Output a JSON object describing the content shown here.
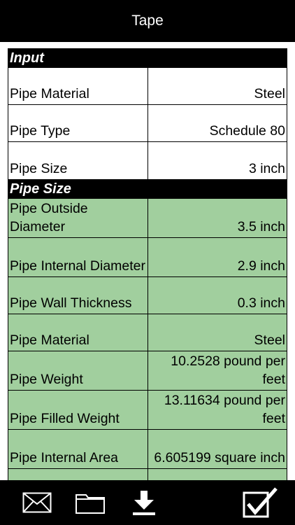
{
  "title": "Tape",
  "colors": {
    "bar": "#000000",
    "result_bg": "#a1cf9e"
  },
  "sections": {
    "input": {
      "header": "Input",
      "rows": [
        {
          "label": "Pipe Material",
          "value": "Steel"
        },
        {
          "label": "Pipe Type",
          "value": "Schedule 80"
        },
        {
          "label": "Pipe Size",
          "value": "3 inch"
        }
      ]
    },
    "pipe_size": {
      "header": "Pipe Size",
      "rows": [
        {
          "label": "Pipe Outside Diameter",
          "value": "3.5 inch"
        },
        {
          "label": "Pipe Internal Diameter",
          "value": "2.9 inch"
        },
        {
          "label": "Pipe Wall Thickness",
          "value": "0.3 inch"
        },
        {
          "label": "Pipe Material",
          "value": "Steel"
        },
        {
          "label": "Pipe Weight",
          "value": "10.2528 pound per feet"
        },
        {
          "label": "Pipe Filled Weight",
          "value": "13.11634 pound per feet"
        },
        {
          "label": "Pipe Internal Area",
          "value": "6.605199 square inch"
        }
      ]
    }
  },
  "toolbar": {
    "icons": [
      "envelope-icon",
      "folder-icon",
      "download-icon",
      "checkmark-icon"
    ]
  }
}
